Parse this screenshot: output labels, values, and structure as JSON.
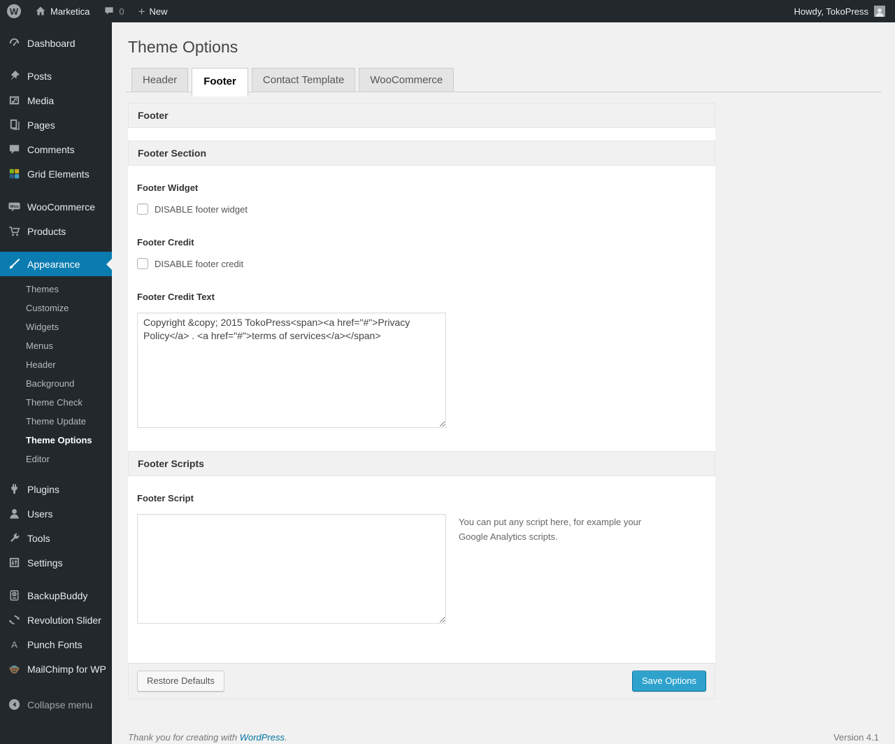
{
  "admin_bar": {
    "site_name": "Marketica",
    "comment_count": "0",
    "new_label": "New",
    "howdy": "Howdy, TokoPress"
  },
  "sidebar": {
    "items": [
      "Dashboard",
      "Posts",
      "Media",
      "Pages",
      "Comments",
      "Grid Elements",
      "WooCommerce",
      "Products",
      "Appearance",
      "Plugins",
      "Users",
      "Tools",
      "Settings",
      "BackupBuddy",
      "Revolution Slider",
      "Punch Fonts",
      "MailChimp for WP"
    ],
    "submenu": [
      "Themes",
      "Customize",
      "Widgets",
      "Menus",
      "Header",
      "Background",
      "Theme Check",
      "Theme Update",
      "Theme Options",
      "Editor"
    ],
    "collapse_label": "Collapse menu"
  },
  "main": {
    "title": "Theme Options",
    "tabs": [
      "Header",
      "Footer",
      "Contact Template",
      "WooCommerce"
    ],
    "active_tab": "Footer"
  },
  "panel": {
    "header_footer": "Footer",
    "header_footer_section": "Footer Section",
    "footer_widget_label": "Footer Widget",
    "footer_widget_checkbox": "DISABLE footer widget",
    "footer_credit_label": "Footer Credit",
    "footer_credit_checkbox": "DISABLE footer credit",
    "footer_credit_text_label": "Footer Credit Text",
    "footer_credit_text_value": "Copyright &copy; 2015 TokoPress<span><a href=\"#\">Privacy Policy</a> . <a href=\"#\">terms of services</a></span>",
    "header_footer_scripts": "Footer Scripts",
    "footer_script_label": "Footer Script",
    "footer_script_value": "",
    "footer_script_help": "You can put any script here, for example your Google Analytics scripts.",
    "restore_button": "Restore Defaults",
    "save_button": "Save Options"
  },
  "page_footer": {
    "thanks": "Thank you for creating with",
    "link": "WordPress",
    "suffix": ".",
    "version": "Version 4.1"
  },
  "colors": {
    "adminbar_bg": "#23282d",
    "accent": "#0a7cb0",
    "primary_button": "#2ea2cc",
    "primary_button_border": "#0074a2",
    "link": "#0074a2"
  }
}
